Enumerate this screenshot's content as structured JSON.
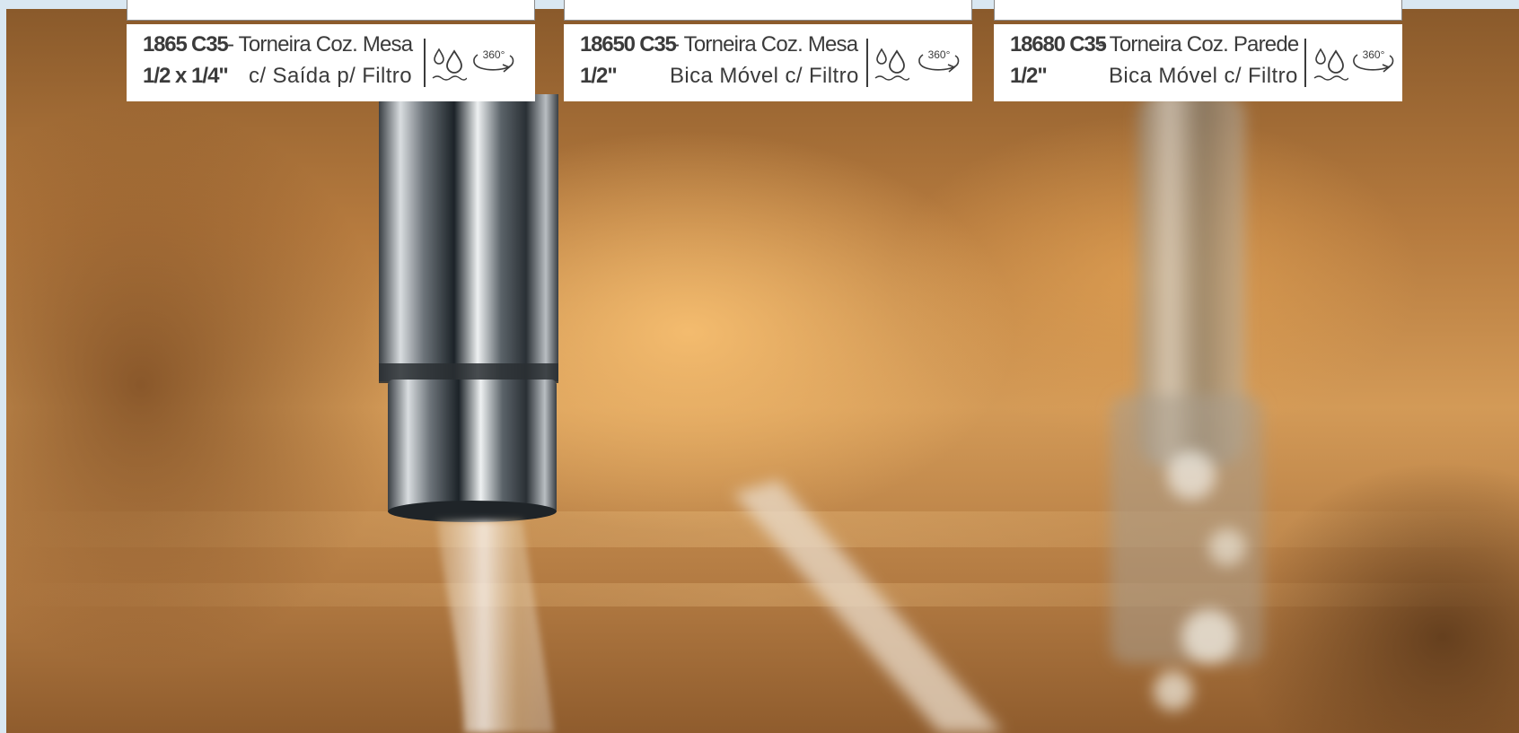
{
  "products": [
    {
      "code": "1865 C35",
      "name": "- Torneira Coz. Mesa",
      "size": "1/2 x 1/4\"",
      "feature": "c/  Saída  p/  Filtro",
      "icons": [
        "water-drops-icon",
        "rotation-360-icon"
      ]
    },
    {
      "code": "18650 C35",
      "name": "- Torneira Coz. Mesa",
      "size": "1/2\"",
      "feature": "Bica  Móvel  c/  Filtro",
      "icons": [
        "water-drops-icon",
        "rotation-360-icon"
      ]
    },
    {
      "code": "18680 C35",
      "name": "- Torneira Coz. Parede",
      "size": "1/2\"",
      "feature": "Bica  Móvel  c/  Filtro",
      "icons": [
        "water-drops-icon",
        "rotation-360-icon"
      ]
    }
  ],
  "icon_text": {
    "rotation": "360°"
  },
  "colors": {
    "text": "#3b3b3b",
    "page_background": "#d9e7f1",
    "card": "#ffffff"
  }
}
